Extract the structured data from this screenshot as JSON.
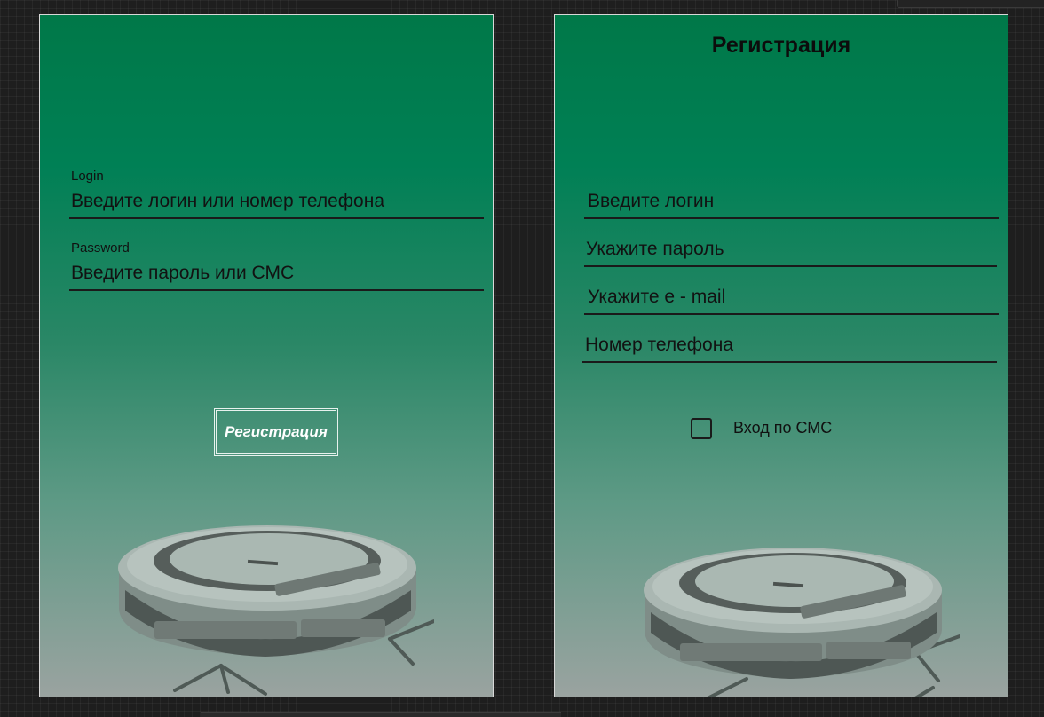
{
  "login_panel": {
    "login_label": "Login",
    "login_placeholder": "Введите логин или номер телефона",
    "password_label": "Password",
    "password_placeholder": "Введите пароль или СМС",
    "register_button": "Регистрация"
  },
  "register_panel": {
    "title": "Регистрация",
    "login_placeholder": "Введите логин",
    "password_placeholder": "Укажите пароль",
    "email_placeholder": "Укажите e - mail",
    "phone_placeholder": "Номер телефона",
    "sms_checkbox_label": "Вход по СМС",
    "sms_checked": false
  },
  "colors": {
    "gradient_top": "#007848",
    "gradient_bottom": "#9aa3a0",
    "text": "#121212"
  },
  "images": [
    "robot-vacuum-image",
    "robot-vacuum-image"
  ]
}
